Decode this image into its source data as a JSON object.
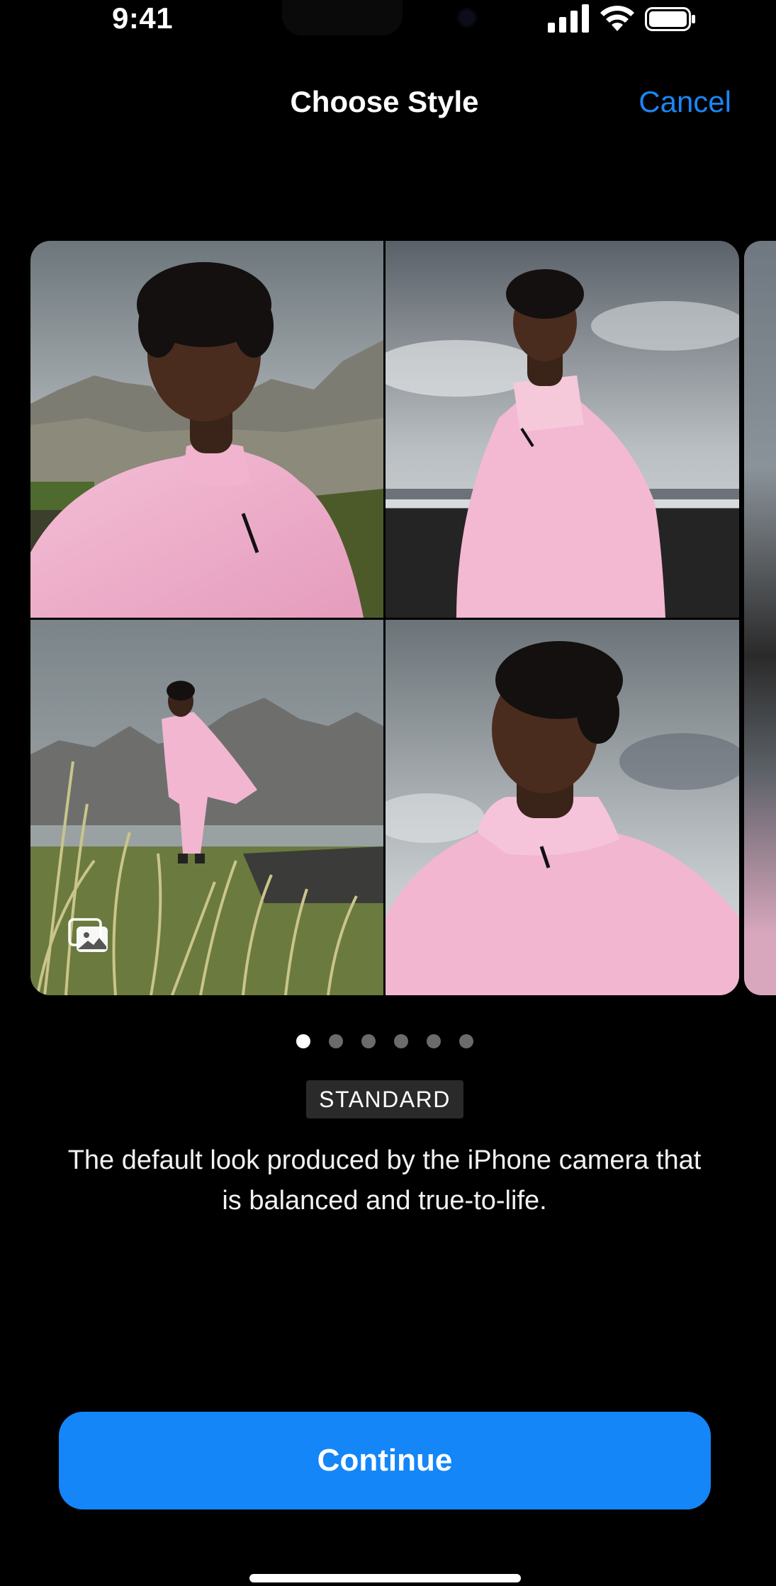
{
  "status_bar": {
    "time": "9:41",
    "signal_icon": "cellular-signal-icon",
    "wifi_icon": "wifi-icon",
    "battery_icon": "battery-icon"
  },
  "nav": {
    "title": "Choose Style",
    "cancel_label": "Cancel",
    "accent_color": "#1a86f5"
  },
  "carousel": {
    "photos": [
      "selfie-mountains",
      "standing-beach",
      "full-body-grass",
      "portrait-sky"
    ],
    "gallery_icon": "photo-gallery-icon"
  },
  "pager": {
    "count": 6,
    "active_index": 0
  },
  "style": {
    "name": "STANDARD",
    "description": "The default look produced by the iPhone camera that is balanced and true-to-life."
  },
  "continue_label": "Continue",
  "button_color": "#1486f8"
}
